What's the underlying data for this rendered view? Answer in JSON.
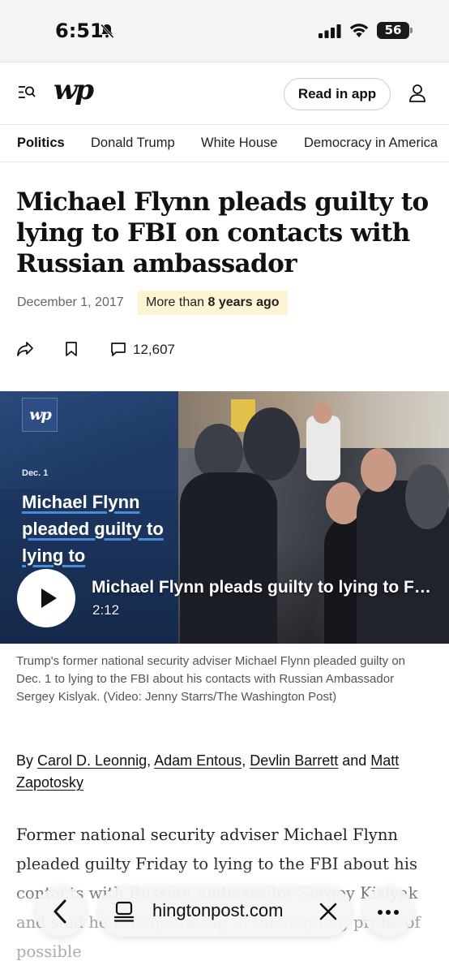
{
  "status_bar": {
    "time": "6:51",
    "battery": "56",
    "icons": [
      "bell-slash-icon",
      "signal-icon",
      "wifi-icon",
      "battery-icon"
    ]
  },
  "header": {
    "logo": "wp",
    "read_in_app": "Read in app",
    "icons": [
      "menu-search-icon",
      "account-icon"
    ]
  },
  "nav": {
    "items": [
      "Politics",
      "Donald Trump",
      "White House",
      "Democracy in America"
    ]
  },
  "article": {
    "headline": "Michael Flynn pleads guilty to lying to FBI on contacts with Russian ambassador",
    "date": "December 1, 2017",
    "age_prefix": "More than ",
    "age_value": "8 years ago",
    "comment_count": "12,607",
    "action_icons": [
      "share-icon",
      "bookmark-icon",
      "comment-icon"
    ]
  },
  "video": {
    "logo": "wp",
    "overlay_date": "Dec. 1",
    "overlay_title": "Michael Flynn pleaded guilty to lying to",
    "title": "Michael Flynn pleads guilty to lying to FBI on contacts with Russian ambassador",
    "duration": "2:12"
  },
  "caption": "Trump's former national security adviser Michael Flynn pleaded guilty on Dec. 1 to lying to the FBI about his contacts with Russian Ambassador Sergey Kislyak. (Video: Jenny Starrs/The Washington Post)",
  "byline": {
    "prefix": "By ",
    "authors": [
      "Carol D. Leonnig",
      "Adam Entous",
      "Devlin Barrett",
      "Matt Zapotosky"
    ],
    "sep1": ", ",
    "sep2": ", ",
    "sep3": " and "
  },
  "body": {
    "paragraph": "Former national security adviser Michael Flynn pleaded guilty Friday to lying to the FBI about his contacts with Russian ambassador Sergey Kislyak and said he is cooperating in the ongoing probe of possible"
  },
  "browser": {
    "url": "hingtonpost.com",
    "icons": [
      "back-icon",
      "tabs-icon",
      "close-icon",
      "more-icon"
    ]
  }
}
